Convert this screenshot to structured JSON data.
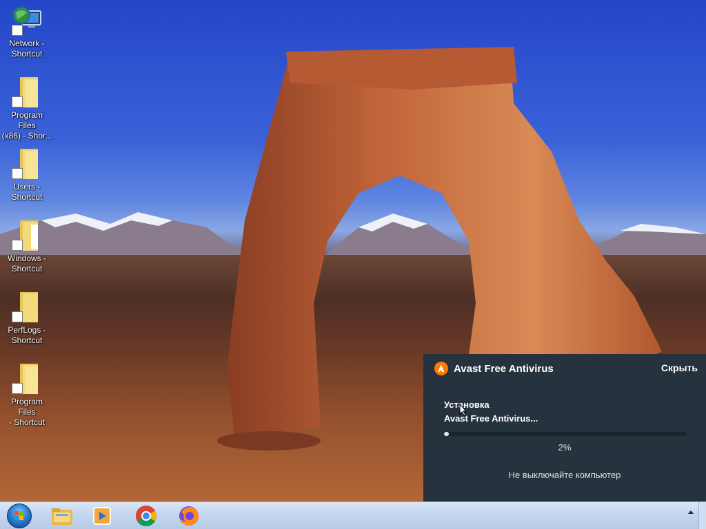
{
  "desktop": {
    "icons": [
      {
        "label": "Network -\nShortcut",
        "icon": "network-icon"
      },
      {
        "label": "Program Files\n(x86) - Shor...",
        "icon": "folder-icon"
      },
      {
        "label": "Users -\nShortcut",
        "icon": "folder-icon"
      },
      {
        "label": "Windows -\nShortcut",
        "icon": "folder-icon"
      },
      {
        "label": "PerfLogs -\nShortcut",
        "icon": "folder-icon"
      },
      {
        "label": "Program Files\n- Shortcut",
        "icon": "folder-icon"
      }
    ]
  },
  "avast": {
    "title": "Avast Free Antivirus",
    "hide_label": "Скрыть",
    "status_line1": "Установка",
    "status_line2": "Avast Free Antivirus...",
    "progress": 0.02,
    "progress_label": "2%",
    "warning": "Не выключайте компьютер",
    "accent_color": "#ff7800",
    "panel_color": "#27323f"
  },
  "taskbar": {
    "items": [
      "start-orb-icon",
      "file-explorer-icon",
      "media-player-icon",
      "chrome-icon",
      "firefox-icon"
    ]
  }
}
